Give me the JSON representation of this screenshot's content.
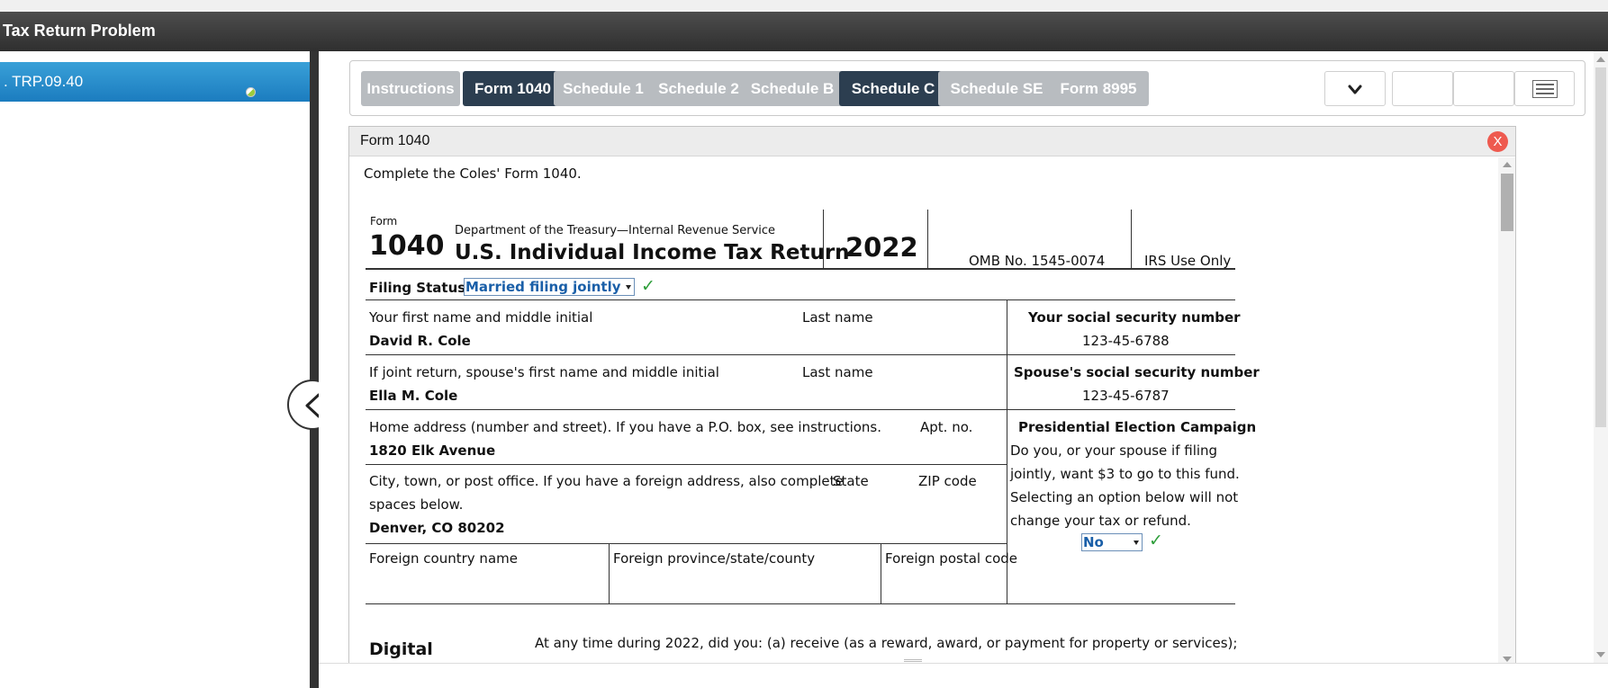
{
  "app": {
    "title": "Tax Return Problem"
  },
  "sidebar": {
    "items": [
      {
        "label": ". TRP.09.40"
      }
    ]
  },
  "tabs": [
    {
      "label": "Instructions",
      "active": false
    },
    {
      "label": "Form 1040",
      "active": true
    },
    {
      "label": "Schedule 1",
      "active": false
    },
    {
      "label": "Schedule 2",
      "active": false
    },
    {
      "label": "Schedule B",
      "active": false
    },
    {
      "label": "Schedule C",
      "active": true
    },
    {
      "label": "Schedule SE",
      "active": false
    },
    {
      "label": "Form 8995",
      "active": false
    }
  ],
  "panel": {
    "title": "Form 1040",
    "close_label": "X",
    "instruction": "Complete the Coles' Form 1040."
  },
  "form": {
    "form_label": "Form",
    "form_number": "1040",
    "agency": "Department of the Treasury—Internal Revenue Service",
    "title": "U.S. Individual Income Tax Return",
    "year": "2022",
    "omb": "OMB No. 1545-0074",
    "irs_use": "IRS Use Only",
    "filing_status": {
      "label": "Filing Status",
      "value": "Married filing jointly"
    },
    "taxpayer": {
      "first_label": "Your first name and middle initial",
      "last_label": "Last name",
      "name": "David R. Cole",
      "ssn_label": "Your social security number",
      "ssn": "123-45-6788"
    },
    "spouse": {
      "first_label": "If joint return, spouse's first name and middle initial",
      "last_label": "Last name",
      "name": "Ella M. Cole",
      "ssn_label": "Spouse's social security number",
      "ssn": "123-45-6787"
    },
    "address": {
      "home_label": "Home address (number and street). If you have a P.O. box, see instructions.",
      "apt_label": "Apt. no.",
      "home": "1820 Elk Avenue",
      "city_label_1": "City, town, or post office. If you have a foreign address, also complete",
      "city_label_2": "spaces below.",
      "state_label": "State",
      "zip_label": "ZIP code",
      "city": "Denver, CO 80202",
      "foreign_country_label": "Foreign country name",
      "foreign_province_label": "Foreign province/state/county",
      "foreign_postal_label": "Foreign postal code"
    },
    "presidential": {
      "title": "Presidential Election Campaign",
      "line1": "Do you, or your spouse if filing",
      "line2": "jointly, want $3 to go to this fund.",
      "line3": "Selecting an option below will not",
      "line4": "change your tax or refund.",
      "value": "No"
    },
    "digital": {
      "label": "Digital",
      "question": "At any time during 2022, did you: (a) receive (as a reward, award, or payment for property or services);"
    }
  },
  "icons": {
    "collapse": "chevron-left-icon",
    "dropdown": "chevron-down-icon",
    "menu": "hamburger-menu-icon",
    "check": "check-icon"
  },
  "colors": {
    "active_tab": "#2c3e50",
    "inactive_tab": "#b8bcc0",
    "sidebar_item": "#1b7cbf",
    "check": "#2e9e3a",
    "close": "#ee5a4f"
  }
}
